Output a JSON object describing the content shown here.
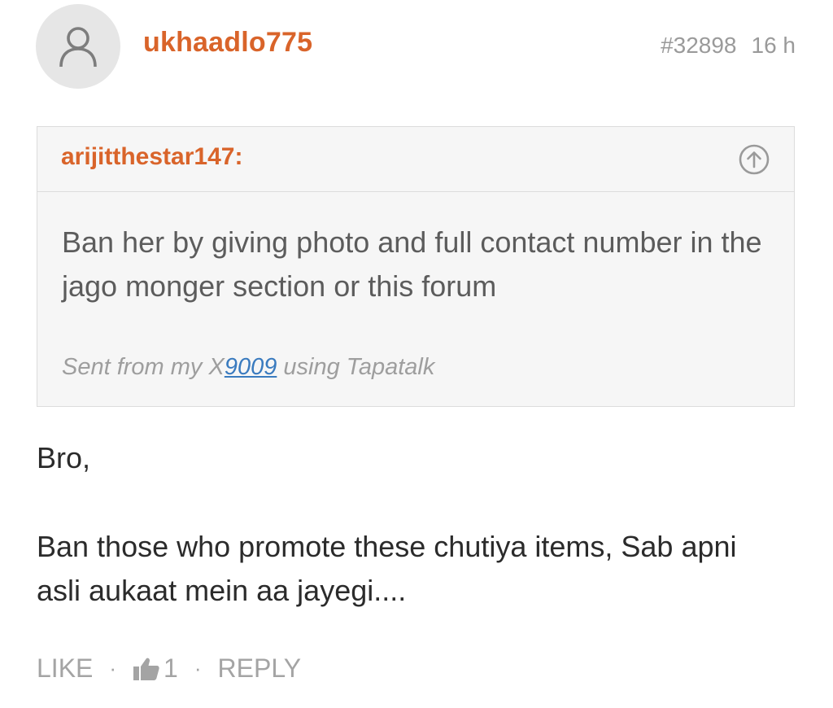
{
  "post": {
    "username": "ukhaadlo775",
    "post_number": "#32898",
    "time_ago": "16 h",
    "quote": {
      "author": "arijitthestar147:",
      "text": "Ban her by giving photo and full contact number in the jago monger section or this forum",
      "signature_prefix": "Sent from my X",
      "signature_link": "9009",
      "signature_suffix": " using Tapatalk"
    },
    "greeting": "Bro,",
    "body": "Ban those who promote these chutiya items, Sab apni asli aukaat mein aa jayegi....",
    "actions": {
      "like_label": "LIKE",
      "separator": "·",
      "like_count": "1",
      "reply_label": "REPLY"
    }
  },
  "colors": {
    "accent": "#d9642a",
    "muted": "#9a9a9a",
    "link": "#3a7bbf",
    "quote_bg": "#f6f6f6"
  },
  "icons": {
    "avatar": "user-outline-icon",
    "quote_jump": "arrow-up-circle-icon",
    "like": "thumbs-up-icon"
  }
}
